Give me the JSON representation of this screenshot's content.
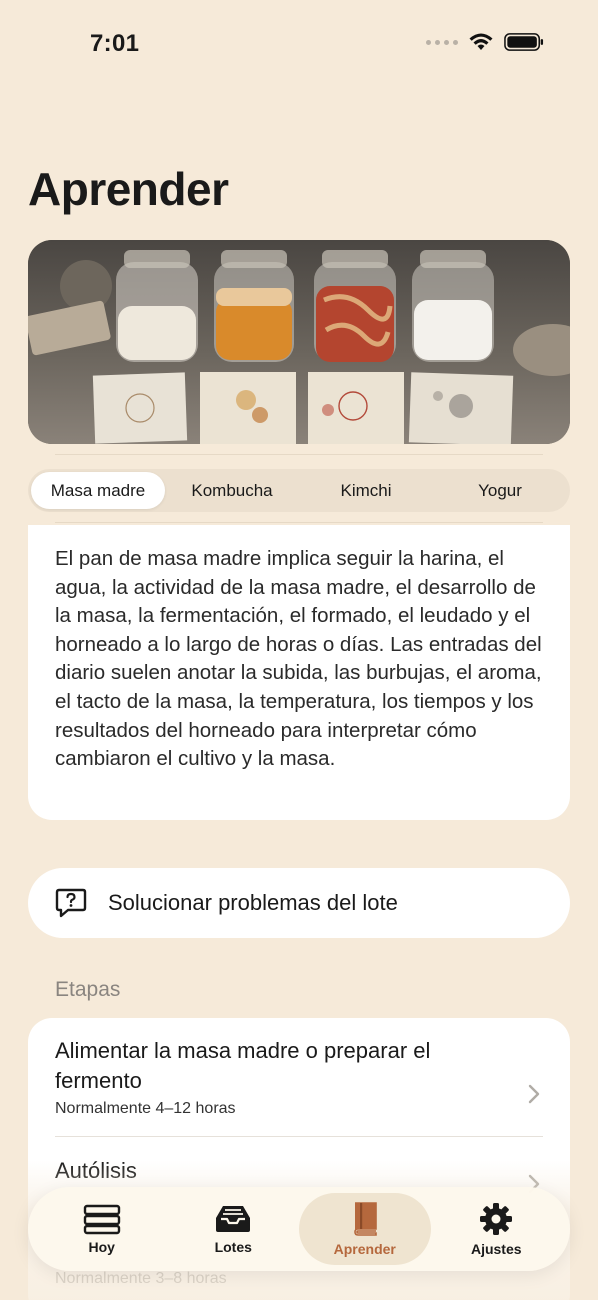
{
  "status_bar": {
    "time": "7:01"
  },
  "page": {
    "title": "Aprender"
  },
  "segments": [
    {
      "label": "Masa madre",
      "active": true
    },
    {
      "label": "Kombucha",
      "active": false
    },
    {
      "label": "Kimchi",
      "active": false
    },
    {
      "label": "Yogur",
      "active": false
    }
  ],
  "description": "El pan de masa madre implica seguir la harina, el agua, la actividad de la masa madre, el desarrollo de la masa, la fermentación, el formado, el leudado y el horneado a lo largo de horas o días. Las entradas del diario suelen anotar la subida, las burbujas, el aroma, el tacto de la masa, la temperatura, los tiempos y los resultados del horneado para interpretar cómo cambiaron el cultivo y la masa.",
  "troubleshoot": {
    "label": "Solucionar problemas del lote",
    "icon": "question-bubble-icon"
  },
  "stages": {
    "title": "Etapas",
    "items": [
      {
        "title": "Alimentar la masa madre o preparar el fermento",
        "duration": "Normalmente 4–12 horas"
      },
      {
        "title": "Autólisis",
        "duration": ""
      },
      {
        "title": "",
        "duration": "Normalmente 3–8 horas"
      }
    ]
  },
  "tabbar": {
    "items": [
      {
        "label": "Hoy",
        "icon": "timeline-icon",
        "active": false
      },
      {
        "label": "Lotes",
        "icon": "tray-icon",
        "active": false
      },
      {
        "label": "Aprender",
        "icon": "book-icon",
        "active": true
      },
      {
        "label": "Ajustes",
        "icon": "gear-icon",
        "active": false
      }
    ]
  },
  "colors": {
    "background": "#f6ead9",
    "accent": "#b5683d",
    "card": "#ffffff"
  }
}
